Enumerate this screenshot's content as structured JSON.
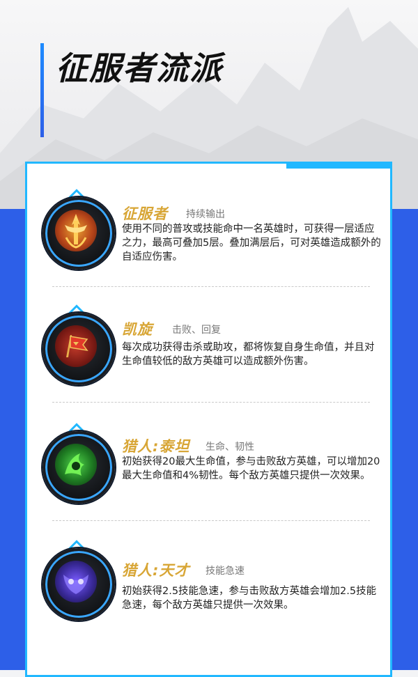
{
  "page": {
    "title": "征服者流派",
    "colors": {
      "accent_blue": "#21b8ff",
      "brand_blue": "#2d5fe8",
      "rune_gold": "#d8a636"
    }
  },
  "runes": [
    {
      "name": "征服者",
      "tag": "持续输出",
      "description": "使用不同的普攻或技能命中一名英雄时，可获得一层适应之力，最高可叠加5层。叠加满层后，可对英雄造成额外的自适应伤害。",
      "icon": "conqueror-icon"
    },
    {
      "name": "凯旋",
      "tag": "击败、回复",
      "description": "每次成功获得击杀或助攻，都将恢复自身生命值，并且对生命值较低的敌方英雄可以造成额外伤害。",
      "icon": "triumph-icon"
    },
    {
      "name": "猎人:泰坦",
      "tag": "生命、韧性",
      "description": "初始获得20最大生命值，参与击败敌方英雄，可以增加20最大生命值和4%韧性。每个敌方英雄只提供一次效果。",
      "icon": "hunter-titan-icon"
    },
    {
      "name": "猎人:天才",
      "tag": "技能急速",
      "description": "初始获得2.5技能急速，参与击败敌方英雄会增加2.5技能急速，每个敌方英雄只提供一次效果。",
      "icon": "hunter-genius-icon"
    }
  ]
}
